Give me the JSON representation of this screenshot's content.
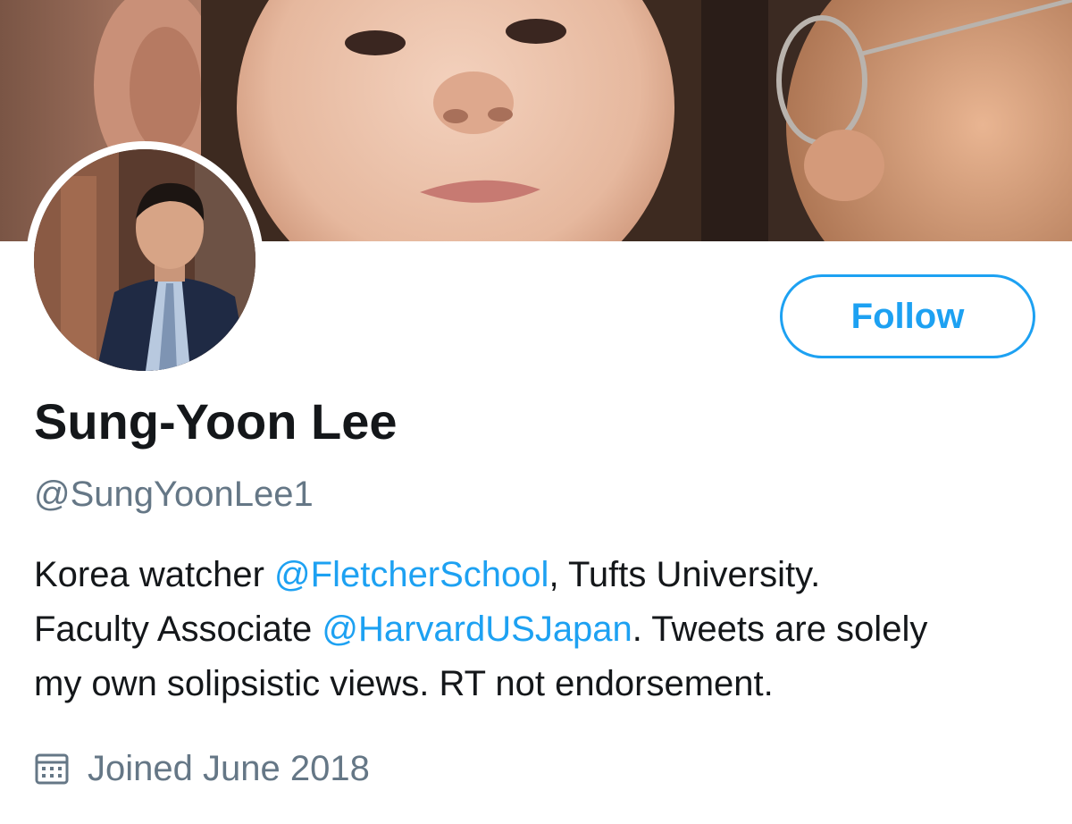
{
  "profile": {
    "display_name": "Sung-Yoon Lee",
    "handle": "@SungYoonLee1",
    "follow_label": "Follow",
    "bio": {
      "line1_prefix": "Korea watcher ",
      "line1_mention": "@FletcherSchool",
      "line1_suffix": ", Tufts University.",
      "line2_prefix": "Faculty Associate ",
      "line2_mention": "@HarvardUSJapan",
      "line2_suffix": ". Tweets are solely",
      "line3": "my own solipsistic views. RT not endorsement."
    },
    "joined": "Joined June 2018",
    "joined_icon": "calendar-icon"
  },
  "colors": {
    "accent": "#1da1f2",
    "text_primary": "#14171a",
    "text_secondary": "#657786"
  }
}
